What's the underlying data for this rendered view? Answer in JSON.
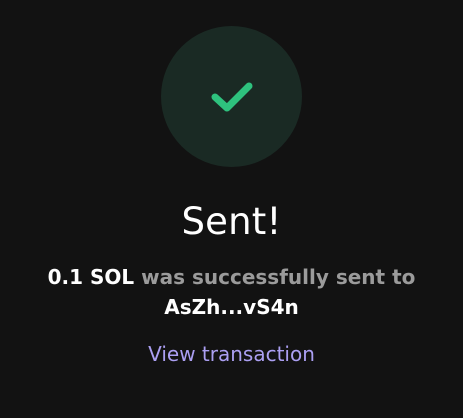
{
  "icons": {
    "status": "check-icon"
  },
  "colors": {
    "background": "#121212",
    "circle": "#1a2a24",
    "check": "#2ec27e",
    "link": "#ab9ff2",
    "muted": "#9b9b9b"
  },
  "title": "Sent!",
  "message": {
    "amount": "0.1 SOL",
    "text": "was successfully sent to",
    "recipient": "AsZh...vS4n"
  },
  "link": {
    "label": "View transaction"
  }
}
